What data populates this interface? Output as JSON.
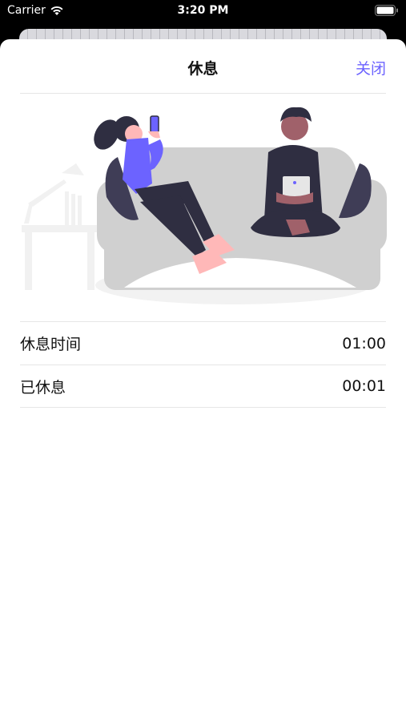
{
  "status_bar": {
    "carrier": "Carrier",
    "time": "3:20 PM"
  },
  "nav": {
    "title": "休息",
    "close_label": "关闭"
  },
  "rows": [
    {
      "label": "休息时间",
      "value": "01:00"
    },
    {
      "label": "已休息",
      "value": "00:01"
    }
  ],
  "colors": {
    "accent": "#6c63ff",
    "dark": "#2f2e41"
  }
}
